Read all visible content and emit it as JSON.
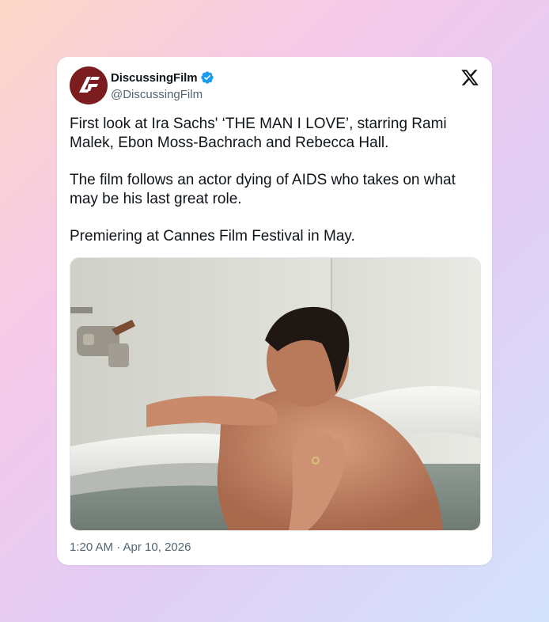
{
  "tweet": {
    "display_name": "DiscussingFilm",
    "handle": "@DiscussingFilm",
    "paragraphs": [
      "First look at Ira Sachs' ‘THE MAN I LOVE’, starring Rami Malek, Ebon Moss-Bachrach and Rebecca Hall.",
      "The film follows an actor dying of AIDS who takes on what may be his last great role.",
      "Premiering at Cannes Film Festival in May."
    ],
    "timestamp": "1:20 AM · Apr 10, 2026",
    "media_alt": "Man in a bathtub with a hand on his back"
  },
  "icons": {
    "avatar": "discussingfilm-logo",
    "verified": "verified-badge-icon",
    "platform": "x-logo-icon"
  },
  "colors": {
    "avatar_bg": "#7b1c1e",
    "verified": "#1d9bf0",
    "text": "#0f1419",
    "secondary_text": "#536471"
  }
}
